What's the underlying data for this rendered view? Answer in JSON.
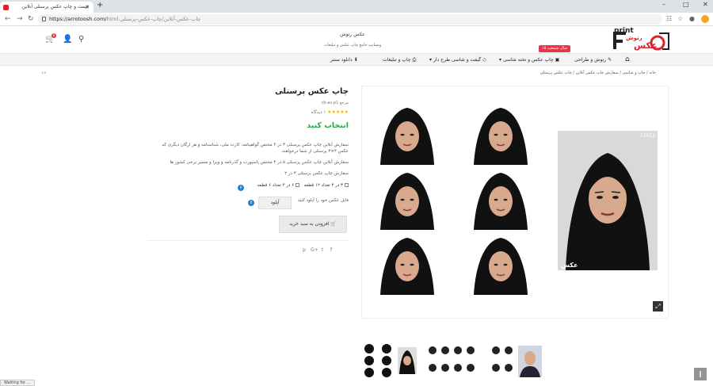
{
  "browser": {
    "tab_title": "قیمت و چاپ عکس پرسنلی آنلاین",
    "close_glyph": "×",
    "newtab_glyph": "+",
    "url_host": "https://arrotoosh.com/",
    "url_path": "html.چاپ-عکس-آنلاین/چاپ-عکس-پرسنلی",
    "status_text": "Waiting for ..."
  },
  "header": {
    "logo_text_main": "عکس",
    "logo_text_sub": "رتوش",
    "logo_text_print": "print",
    "sale_badge": "۱۵ سال شمعت",
    "tagline_title": "عکس رتوش",
    "tagline_sub": "وبسایت جامع چاپ عکس و تبلیغات",
    "cart_count": "0"
  },
  "nav": {
    "items": [
      {
        "label": "رتوش و طراحی"
      },
      {
        "label": "چاپ عکس و تخته شاسی"
      },
      {
        "label": "گیفت و شاسی طرح دار"
      },
      {
        "label": "چاپ و تبلیغات"
      },
      {
        "label": "دانلود سنتر"
      }
    ]
  },
  "breadcrumb": {
    "text": "خانه  /  چاپ و شاسی  /  سفارش چاپ عکس آنلاین  /  چاپ عکس پرسنلی"
  },
  "product": {
    "title": "چاپ عکس پرسنلی",
    "sku": "مرجع cb-as-p1",
    "rating_text": "۱ دیدگاه",
    "stars": "★★★★★",
    "price_label": "انتخاب کنید",
    "desc_line1": "سفارش آنلاین چاپ عکس پرسنلی ۳ در ۴ مختص گواهینامه، کارت ملی، شناسنامه و هر ارگان دیگری که",
    "desc_line2": "عکس ۴×۳ پرسنلی از شما درخواهند.",
    "desc_line3": "سفارش آنلاین چاپ عکس پرسنلی ۵ در ۴ مختص پاسپورت و گذرنامه و ویزا و مسیر برخی کشور ها",
    "desc_line4": "سفارش چاپ عکس پرسنلی ۳ در ۲",
    "option1": "۳ در ۴ تعداد ۱۲ قطعه",
    "option2": "۶ در ۴ تعداد ۶ قطعه",
    "upload_label": "فایل عکس خود را آپلود کنید",
    "upload_button": "آپلود",
    "add_to_cart": "افزودن به سبد خرید",
    "photo_number": "12652",
    "photo_watermark": "عکس",
    "info_glyph": "i"
  },
  "social": {
    "facebook": "f",
    "twitter": "t",
    "google": "G+",
    "pinterest": "p"
  },
  "icons": {
    "home": "home-icon",
    "search": "search-icon",
    "user": "user-icon",
    "cart": "cart-icon",
    "zoom": "expand-icon"
  },
  "colors": {
    "brand_red": "#d9232d",
    "price_green": "#2aa54a",
    "info_blue": "#2a7fd4",
    "star_gold": "#f5b301"
  }
}
